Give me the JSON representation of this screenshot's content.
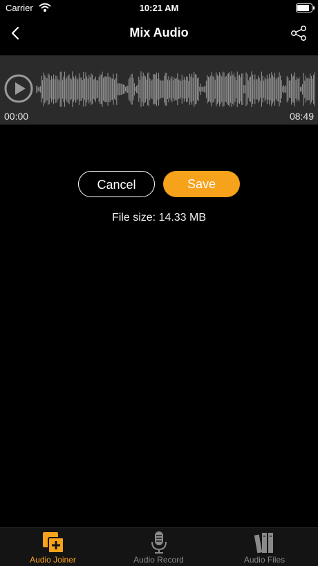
{
  "status_bar": {
    "carrier": "Carrier",
    "time": "10:21 AM",
    "battery_level": 1.0
  },
  "nav": {
    "title": "Mix Audio",
    "back_icon": "chevron-left-icon",
    "share_icon": "share-icon"
  },
  "player": {
    "start_time": "00:00",
    "end_time": "08:49",
    "play_icon": "play-icon"
  },
  "actions": {
    "cancel_label": "Cancel",
    "save_label": "Save",
    "file_size": "File size: 14.33 MB"
  },
  "tabs": [
    {
      "label": "Audio Joiner",
      "icon": "audio-joiner-icon",
      "active": true
    },
    {
      "label": "Audio Record",
      "icon": "microphone-icon",
      "active": false
    },
    {
      "label": "Audio Files",
      "icon": "audio-files-icon",
      "active": false
    }
  ],
  "colors": {
    "accent": "#f7a21b",
    "background": "#000000",
    "wave_panel": "#2b2b2b",
    "waveform": "#9a9a9a",
    "tab_inactive": "#8a8a8a"
  }
}
